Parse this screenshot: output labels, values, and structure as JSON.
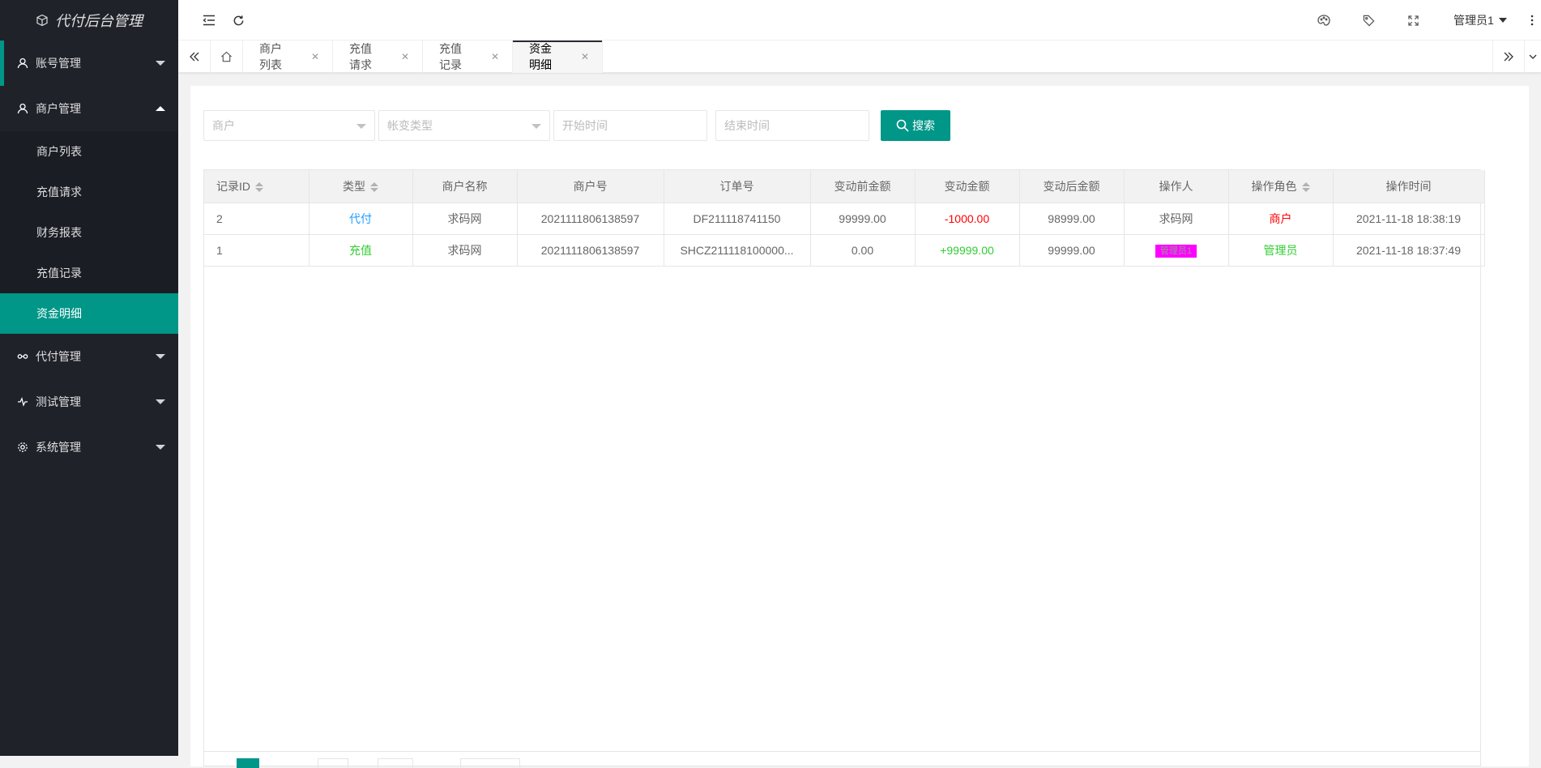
{
  "app": {
    "title": "代付后台管理"
  },
  "sidebar": {
    "groups": [
      {
        "label": "账号管理",
        "icon": "user-icon",
        "expanded": false
      },
      {
        "label": "商户管理",
        "icon": "user-icon",
        "expanded": true,
        "children": [
          "商户列表",
          "充值请求",
          "财务报表",
          "充值记录",
          "资金明细"
        ],
        "selected": "资金明细"
      },
      {
        "label": "代付管理",
        "icon": "link-icon",
        "expanded": false
      },
      {
        "label": "测试管理",
        "icon": "pulse-icon",
        "expanded": false
      },
      {
        "label": "系统管理",
        "icon": "gear-icon",
        "expanded": false
      }
    ]
  },
  "header": {
    "left_icons": [
      "menu-fold-icon",
      "refresh-icon"
    ],
    "right_icons": [
      "theme-icon",
      "tag-icon",
      "fullscreen-icon",
      "more-icon"
    ],
    "user": "管理员1"
  },
  "tabs": {
    "items": [
      {
        "label": "商户列表",
        "active": false
      },
      {
        "label": "充值请求",
        "active": false
      },
      {
        "label": "充值记录",
        "active": false
      },
      {
        "label": "资金明细",
        "active": true
      }
    ]
  },
  "filters": {
    "merchant_placeholder": "商户",
    "type_placeholder": "帐变类型",
    "start_placeholder": "开始时间",
    "end_placeholder": "结束时间",
    "search_label": "搜索"
  },
  "table": {
    "headers": [
      "记录ID",
      "类型",
      "商户名称",
      "商户号",
      "订单号",
      "变动前金额",
      "变动金额",
      "变动后金额",
      "操作人",
      "操作角色",
      "操作时间"
    ],
    "rows": [
      {
        "id": "2",
        "type": "代付",
        "merchant_name": "求码网",
        "merchant_no": "2021111806138597",
        "order_no": "DF211118741150",
        "before": "99999.00",
        "change": "-1000.00",
        "after": "98999.00",
        "operator": "求码网",
        "role": "商户",
        "time": "2021-11-18 18:38:19"
      },
      {
        "id": "1",
        "type": "充值",
        "merchant_name": "求码网",
        "merchant_no": "2021111806138597",
        "order_no": "SHCZ211118100000...",
        "before": "0.00",
        "change": "+99999.00",
        "after": "99999.00",
        "operator": "管理员1",
        "role": "管理员",
        "time": "2021-11-18 18:37:49"
      }
    ]
  },
  "colors": {
    "accent": "#009688",
    "sidebar_bg": "#20222a",
    "blue": "#1e9fff",
    "green": "#33cc33",
    "red": "#ff0000",
    "magenta": "#ff00ff"
  }
}
